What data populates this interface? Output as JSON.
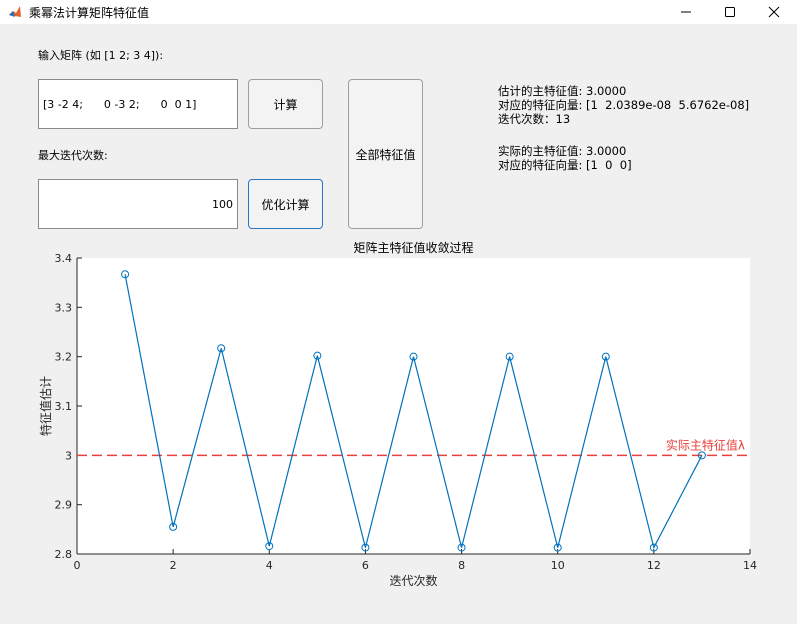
{
  "window": {
    "title": "乘幂法计算矩阵特征值",
    "minimize_icon": "minimize-icon",
    "maximize_icon": "maximize-icon",
    "close_icon": "close-icon"
  },
  "form": {
    "matrix_label": "输入矩阵 (如 [1 2; 3 4]):",
    "matrix_value": "[3 -2 4;      0 -3 2;      0  0 1]",
    "iter_label": "最大迭代次数:",
    "iter_value": "100",
    "compute_label": "计算",
    "optimize_label": "优化计算",
    "all_label": "全部特征值"
  },
  "results": {
    "line1": "估计的主特征值: 3.0000",
    "line2": "对应的特征向量: [1  2.0389e-08  5.6762e-08]",
    "line3": "迭代次数：13",
    "line4": "实际的主特征值: 3.0000",
    "line5": "对应的特征向量: [1  0  0]"
  },
  "chart_data": {
    "type": "line",
    "title": "矩阵主特征值收敛过程",
    "xlabel": "迭代次数",
    "ylabel": "特征值估计",
    "xlim": [
      0,
      14
    ],
    "ylim": [
      2.8,
      3.4
    ],
    "xticks": [
      "0",
      "2",
      "4",
      "6",
      "8",
      "10",
      "12",
      "14"
    ],
    "yticks": [
      "2.8",
      "2.9",
      "3",
      "3.1",
      "3.2",
      "3.3",
      "3.4"
    ],
    "series": [
      {
        "x": [
          1,
          2,
          3,
          4,
          5,
          6,
          7,
          8,
          9,
          10,
          11,
          12,
          13
        ],
        "y": [
          3.367,
          2.855,
          3.217,
          2.816,
          3.202,
          2.813,
          3.2,
          2.813,
          3.2,
          2.813,
          3.2,
          2.813,
          3.0
        ],
        "color": "#0072bd"
      }
    ],
    "reference_line": {
      "y": 3.0,
      "label": "实际主特征值λ",
      "color": "#e8403a"
    },
    "grid": false
  }
}
